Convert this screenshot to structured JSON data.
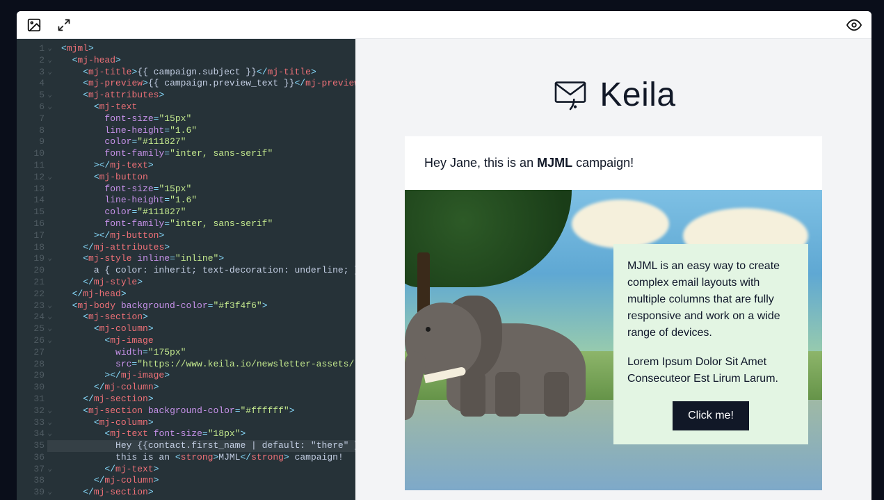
{
  "toolbar": {
    "image_icon": "image",
    "expand_icon": "expand",
    "preview_icon": "eye"
  },
  "editor": {
    "line_numbers": [
      "1",
      "2",
      "3",
      "4",
      "5",
      "6",
      "7",
      "8",
      "9",
      "10",
      "11",
      "12",
      "13",
      "14",
      "15",
      "16",
      "17",
      "18",
      "19",
      "20",
      "21",
      "22",
      "23",
      "24",
      "25",
      "26",
      "27",
      "28",
      "29",
      "30",
      "31",
      "32",
      "33",
      "34",
      "35",
      "36",
      "37",
      "38",
      "39"
    ],
    "fold_lines": [
      1,
      2,
      3,
      5,
      6,
      12,
      19,
      23,
      24,
      25,
      26,
      32,
      33,
      34,
      37,
      39
    ],
    "highlighted_line": 35,
    "code": {
      "l1": {
        "indent": "",
        "open": "<",
        "tag": "mjml",
        "close": ">"
      },
      "l2": {
        "indent": "  ",
        "open": "<",
        "tag": "mj-head",
        "close": ">"
      },
      "l3": {
        "indent": "    ",
        "open": "<",
        "tag": "mj-title",
        "mid": ">",
        "text": "{{ campaign.subject }}",
        "end_open": "</",
        "end_tag": "mj-title",
        "end_close": ">"
      },
      "l4": {
        "indent": "    ",
        "open": "<",
        "tag": "mj-preview",
        "mid": ">",
        "text": "{{ campaign.preview_text }}",
        "end_open": "</",
        "end_tag": "mj-preview",
        "end_close": ">"
      },
      "l5": {
        "indent": "    ",
        "open": "<",
        "tag": "mj-attributes",
        "close": ">"
      },
      "l6": {
        "indent": "      ",
        "open": "<",
        "tag": "mj-text"
      },
      "l7": {
        "indent": "        ",
        "attr": "font-size",
        "eq": "=",
        "val": "\"15px\""
      },
      "l8": {
        "indent": "        ",
        "attr": "line-height",
        "eq": "=",
        "val": "\"1.6\""
      },
      "l9": {
        "indent": "        ",
        "attr": "color",
        "eq": "=",
        "val": "\"#111827\""
      },
      "l10": {
        "indent": "        ",
        "attr": "font-family",
        "eq": "=",
        "val": "\"inter, sans-serif\""
      },
      "l11": {
        "indent": "      ",
        "open": "></",
        "tag": "mj-text",
        "close": ">"
      },
      "l12": {
        "indent": "      ",
        "open": "<",
        "tag": "mj-button"
      },
      "l13": {
        "indent": "        ",
        "attr": "font-size",
        "eq": "=",
        "val": "\"15px\""
      },
      "l14": {
        "indent": "        ",
        "attr": "line-height",
        "eq": "=",
        "val": "\"1.6\""
      },
      "l15": {
        "indent": "        ",
        "attr": "color",
        "eq": "=",
        "val": "\"#111827\""
      },
      "l16": {
        "indent": "        ",
        "attr": "font-family",
        "eq": "=",
        "val": "\"inter, sans-serif\""
      },
      "l17": {
        "indent": "      ",
        "open": "></",
        "tag": "mj-button",
        "close": ">"
      },
      "l18": {
        "indent": "    ",
        "open": "</",
        "tag": "mj-attributes",
        "close": ">"
      },
      "l19": {
        "indent": "    ",
        "open": "<",
        "tag": "mj-style",
        "sp": " ",
        "attr": "inline",
        "eq": "=",
        "val": "\"inline\"",
        "close": ">"
      },
      "l20": {
        "indent": "      ",
        "text": "a { color: inherit; text-decoration: underline; }"
      },
      "l21": {
        "indent": "    ",
        "open": "</",
        "tag": "mj-style",
        "close": ">"
      },
      "l22": {
        "indent": "  ",
        "open": "</",
        "tag": "mj-head",
        "close": ">"
      },
      "l23": {
        "indent": "  ",
        "open": "<",
        "tag": "mj-body",
        "sp": " ",
        "attr": "background-color",
        "eq": "=",
        "val": "\"#f3f4f6\"",
        "close": ">"
      },
      "l24": {
        "indent": "    ",
        "open": "<",
        "tag": "mj-section",
        "close": ">"
      },
      "l25": {
        "indent": "      ",
        "open": "<",
        "tag": "mj-column",
        "close": ">"
      },
      "l26": {
        "indent": "        ",
        "open": "<",
        "tag": "mj-image"
      },
      "l27": {
        "indent": "          ",
        "attr": "width",
        "eq": "=",
        "val": "\"175px\""
      },
      "l28": {
        "indent": "          ",
        "attr": "src",
        "eq": "=",
        "val": "\"https://www.keila.io/newsletter-assets/logo-wi"
      },
      "l29": {
        "indent": "        ",
        "open": "></",
        "tag": "mj-image",
        "close": ">"
      },
      "l30": {
        "indent": "      ",
        "open": "</",
        "tag": "mj-column",
        "close": ">"
      },
      "l31": {
        "indent": "    ",
        "open": "</",
        "tag": "mj-section",
        "close": ">"
      },
      "l32": {
        "indent": "    ",
        "open": "<",
        "tag": "mj-section",
        "sp": " ",
        "attr": "background-color",
        "eq": "=",
        "val": "\"#ffffff\"",
        "close": ">"
      },
      "l33": {
        "indent": "      ",
        "open": "<",
        "tag": "mj-column",
        "close": ">"
      },
      "l34": {
        "indent": "        ",
        "open": "<",
        "tag": "mj-text",
        "sp": " ",
        "attr": "font-size",
        "eq": "=",
        "val": "\"18px\"",
        "close": ">"
      },
      "l35": {
        "indent": "          ",
        "text": "Hey {{contact.first_name | default: \"there\" }},"
      },
      "l36": {
        "indent": "          ",
        "pre": "this is an ",
        "open": "<",
        "tag": "strong",
        "mid": ">",
        "text": "MJML",
        "end_open": "</",
        "end_tag": "strong",
        "end_close": ">",
        "suf": " campaign!"
      },
      "l37": {
        "indent": "        ",
        "open": "</",
        "tag": "mj-text",
        "close": ">"
      },
      "l38": {
        "indent": "      ",
        "open": "</",
        "tag": "mj-column",
        "close": ">"
      },
      "l39": {
        "indent": "    ",
        "open": "</",
        "tag": "mj-section",
        "close": ">"
      }
    }
  },
  "preview": {
    "brand": "Keila",
    "greeting_pre": "Hey Jane, this is an ",
    "greeting_bold": "MJML",
    "greeting_post": " campaign!",
    "callout_p1": "MJML is an easy way to create complex email layouts with multiple columns that are fully responsive and work on a wide range of devices.",
    "callout_p2": "Lorem Ipsum Dolor Sit Amet Consecuteor Est Lirum Larum.",
    "cta": "Click me!"
  }
}
